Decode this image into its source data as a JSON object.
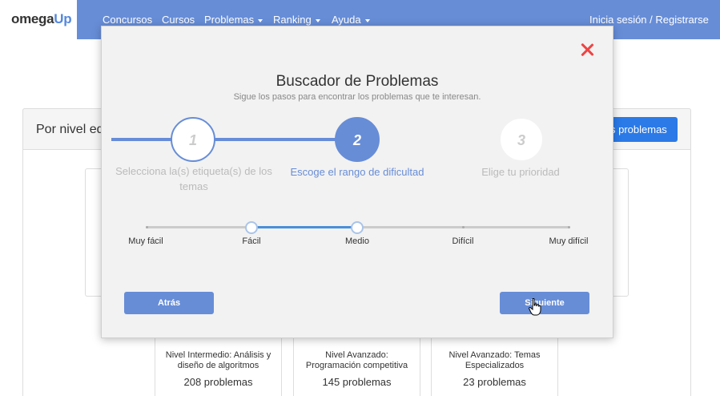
{
  "navbar": {
    "logo_part1": "omega",
    "logo_part2": "Up",
    "items": [
      {
        "label": "Concursos"
      },
      {
        "label": "Cursos"
      },
      {
        "label": "Problemas"
      },
      {
        "label": "Ranking"
      },
      {
        "label": "Ayuda"
      }
    ],
    "login": "Inicia sesión / Registrarse"
  },
  "background": {
    "card_title": "Por nivel ed",
    "button_label": "s problemas",
    "levels": [
      {
        "name": "Nivel Intermedio: Análisis y diseño de algoritmos",
        "count": "208 problemas"
      },
      {
        "name": "Nivel Avanzado: Programación competitiva",
        "count": "145 problemas"
      },
      {
        "name": "Nivel Avanzado: Temas Especializados",
        "count": "23 problemas"
      }
    ]
  },
  "modal": {
    "title": "Buscador de Problemas",
    "subtitle": "Sigue los pasos para encontrar los problemas que te interesan.",
    "steps": [
      {
        "number": "1",
        "label": "Selecciona la(s) etiqueta(s) de los temas",
        "state": "completed"
      },
      {
        "number": "2",
        "label": "Escoge el rango de dificultad",
        "state": "active"
      },
      {
        "number": "3",
        "label": "Elige tu prioridad",
        "state": "pending"
      }
    ],
    "slider": {
      "marks": [
        "Muy fácil",
        "Fácil",
        "Medio",
        "Difícil",
        "Muy difícil"
      ],
      "range_start": "Fácil",
      "range_end": "Medio"
    },
    "back_label": "Atrás",
    "next_label": "Siguiente"
  },
  "colors": {
    "navbar": "#678dd7",
    "accent": "#678dd7",
    "close": "#ee4444",
    "bg_button": "#2b7ae8"
  }
}
